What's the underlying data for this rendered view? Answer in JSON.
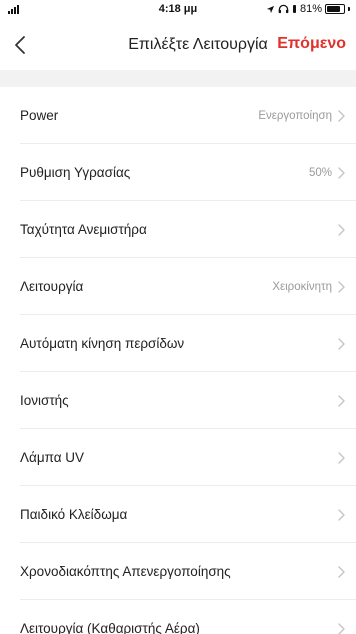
{
  "status_bar": {
    "time": "4:18 μμ",
    "battery": "81%",
    "battery_level": 0.81
  },
  "header": {
    "title": "Επιλέξτε Λειτουργία",
    "next_label": "Επόμενο"
  },
  "rows": [
    {
      "label": "Power",
      "value": "Ενεργοποίηση"
    },
    {
      "label": "Ρυθμιση Υγρασίας",
      "value": "50%"
    },
    {
      "label": "Ταχύτητα Ανεμιστήρα",
      "value": ""
    },
    {
      "label": "Λειτουργία",
      "value": "Χειροκίνητη"
    },
    {
      "label": "Αυτόματη κίνηση περσίδων",
      "value": ""
    },
    {
      "label": "Ιονιστής",
      "value": ""
    },
    {
      "label": "Λάμπα UV",
      "value": ""
    },
    {
      "label": "Παιδικό Κλείδωμα",
      "value": ""
    },
    {
      "label": "Χρονοδιακόπτης Απενεργοποίησης",
      "value": ""
    },
    {
      "label": "Λειτουργία (Καθαριστής Αέρα)",
      "value": ""
    }
  ],
  "colors": {
    "accent": "#e0312c",
    "value_text": "#9a9a9a"
  }
}
